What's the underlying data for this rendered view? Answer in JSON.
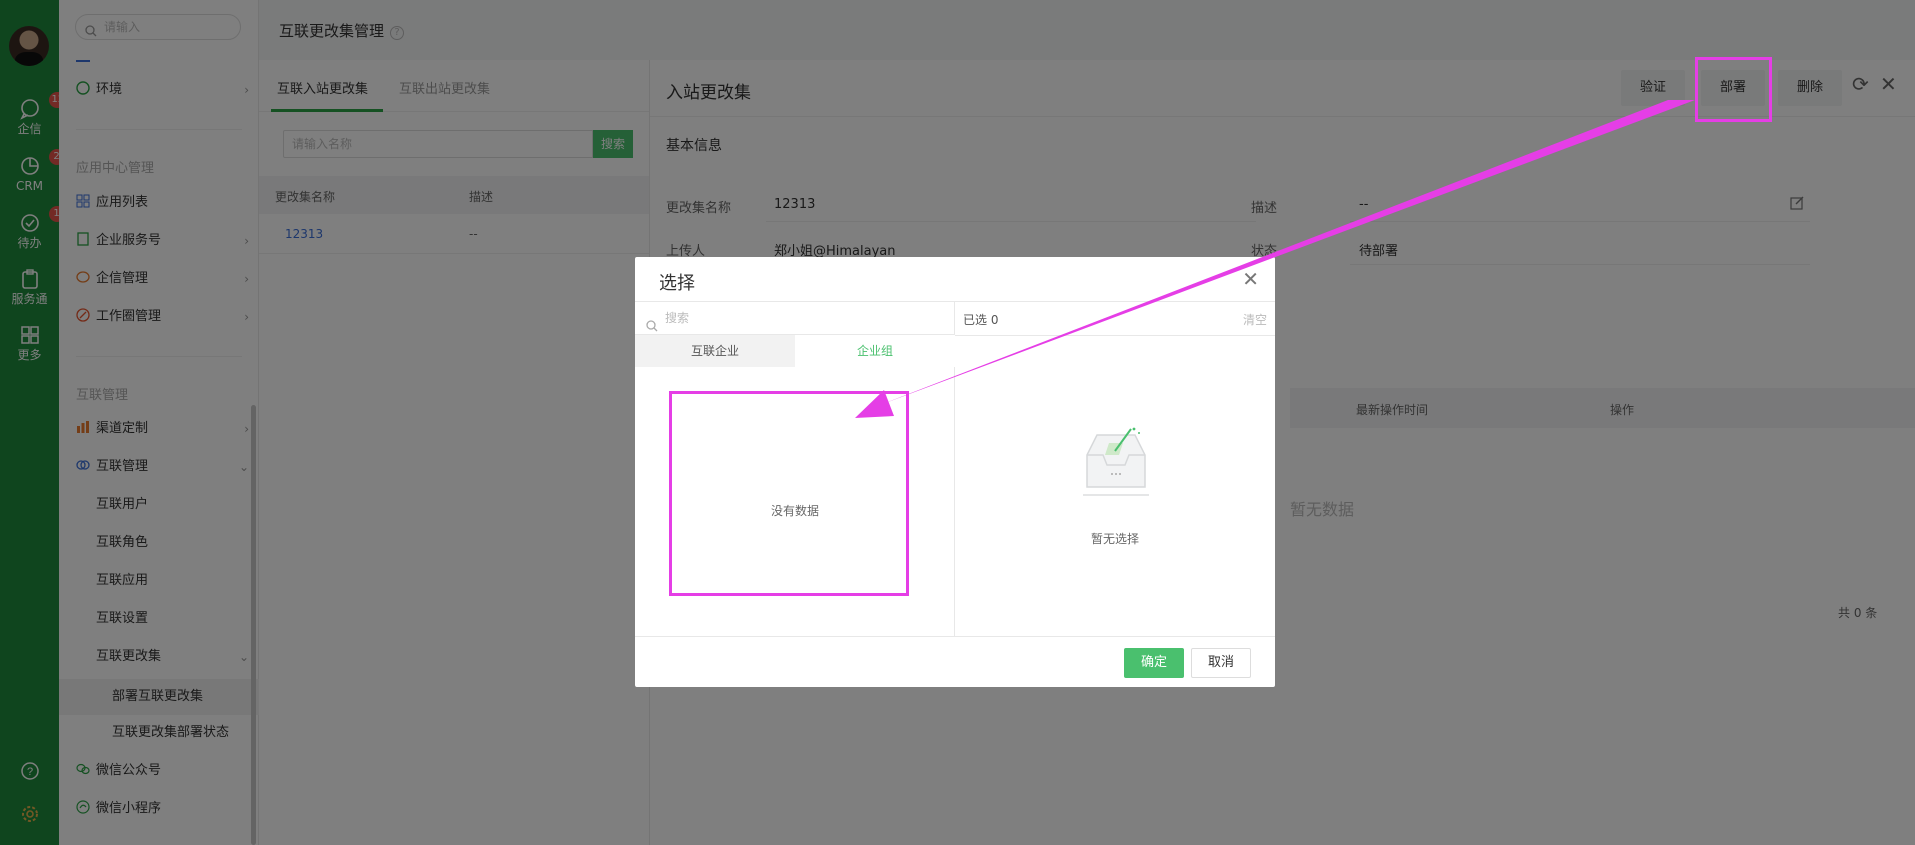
{
  "rail": {
    "items": [
      {
        "label": "企信",
        "badge": "12"
      },
      {
        "label": "CRM",
        "badge": "2"
      },
      {
        "label": "待办",
        "badge": "1"
      },
      {
        "label": "服务通",
        "badge": ""
      },
      {
        "label": "更多",
        "badge": ""
      }
    ]
  },
  "nav": {
    "search_placeholder": "请输入",
    "env_label": "环境",
    "group_app": "应用中心管理",
    "app_items": [
      "应用列表",
      "企业服务号",
      "企信管理",
      "工作圈管理"
    ],
    "group_interconnect": "互联管理",
    "channel": "渠道定制",
    "interconnect": "互联管理",
    "sub_items": [
      "互联用户",
      "互联角色",
      "互联应用",
      "互联设置",
      "互联更改集"
    ],
    "deep_items": [
      "部署互联更改集",
      "互联更改集部署状态"
    ],
    "wechat_items": [
      "微信公众号",
      "微信小程序"
    ]
  },
  "page": {
    "title": "互联更改集管理",
    "help": "?"
  },
  "list": {
    "tabs": [
      "互联入站更改集",
      "互联出站更改集"
    ],
    "search_placeholder": "请输入名称",
    "search_button": "搜索",
    "columns": [
      "更改集名称",
      "描述"
    ],
    "rows": [
      {
        "name": "12313",
        "desc": "--"
      }
    ]
  },
  "drawer": {
    "title": "入站更改集",
    "buttons": {
      "verify": "验证",
      "deploy": "部署",
      "delete": "删除"
    },
    "section": "基本信息",
    "fields": {
      "name_label": "更改集名称",
      "name_value": "12313",
      "desc_label": "描述",
      "desc_value": "--",
      "uploader_label": "上传人",
      "uploader_value": "郑小姐@Himalayan",
      "status_label": "状态",
      "status_value": "待部署"
    },
    "table_columns": [
      "最新操作时间",
      "操作"
    ],
    "empty_text": "暂无数据",
    "total": "共 0 条"
  },
  "dialog": {
    "title": "选择",
    "search_placeholder": "搜索",
    "tabs": [
      "互联企业",
      "企业组"
    ],
    "no_data": "没有数据",
    "selected": "已选 0",
    "clear": "清空",
    "no_selection": "暂无选择",
    "ok": "确定",
    "cancel": "取消"
  },
  "colors": {
    "rail": "#1f8a3c",
    "accent": "#4ac06e",
    "highlight": "#e53ee6"
  }
}
